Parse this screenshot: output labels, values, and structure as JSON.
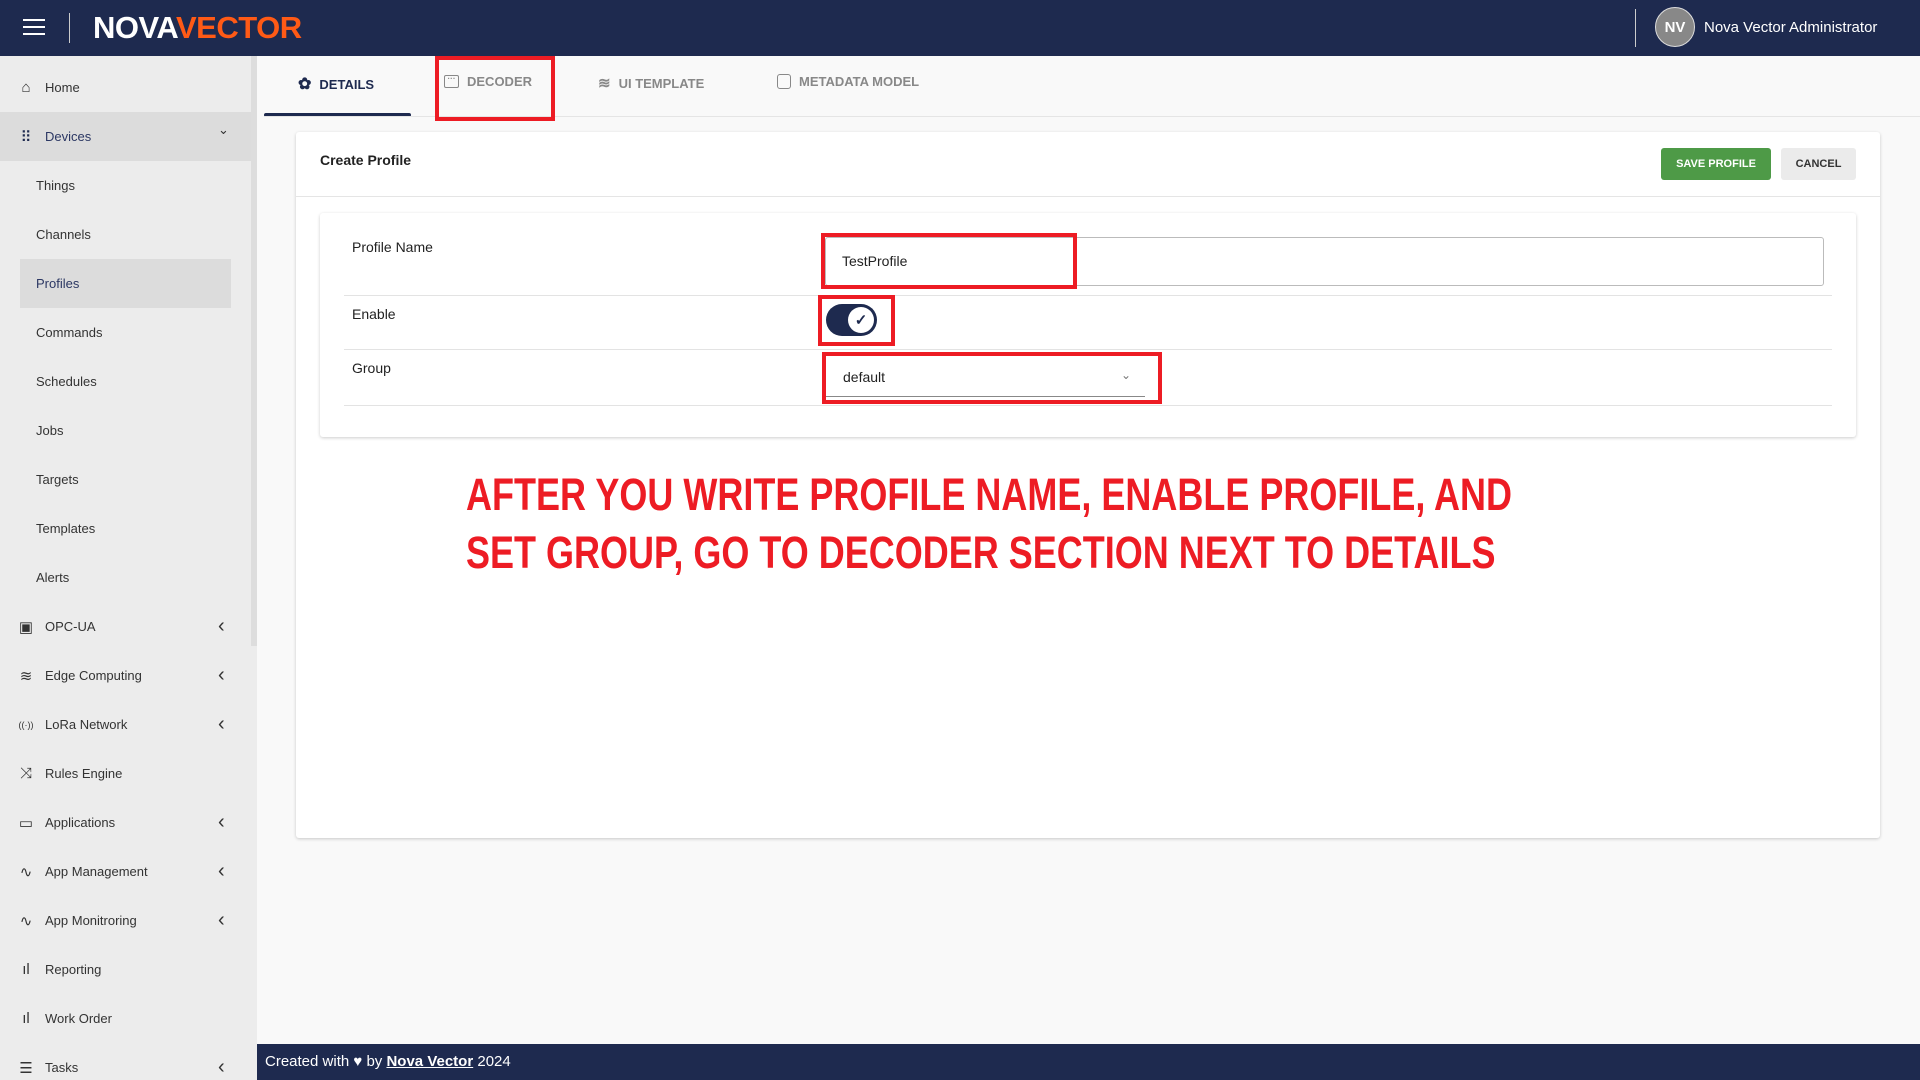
{
  "header": {
    "logo_part1": "NOVA",
    "logo_part2": "VECTOR",
    "avatar_initials": "NV",
    "user_name": "Nova Vector Administrator"
  },
  "sidebar": {
    "items": [
      {
        "label": "Home",
        "icon": "home-icon"
      },
      {
        "label": "Devices",
        "icon": "grid-dots-icon",
        "expanded": true
      },
      {
        "label": "Things"
      },
      {
        "label": "Channels"
      },
      {
        "label": "Profiles",
        "selected": true
      },
      {
        "label": "Commands"
      },
      {
        "label": "Schedules"
      },
      {
        "label": "Jobs"
      },
      {
        "label": "Targets"
      },
      {
        "label": "Templates"
      },
      {
        "label": "Alerts"
      },
      {
        "label": "OPC-UA",
        "icon": "apps-icon"
      },
      {
        "label": "Edge Computing",
        "icon": "layers-icon"
      },
      {
        "label": "LoRa Network",
        "icon": "antenna-icon"
      },
      {
        "label": "Rules Engine",
        "icon": "shuffle-icon"
      },
      {
        "label": "Applications",
        "icon": "monitor-icon"
      },
      {
        "label": "App Management",
        "icon": "activity-icon"
      },
      {
        "label": "App Monitroring",
        "icon": "activity-icon"
      },
      {
        "label": "Reporting",
        "icon": "bar-chart-icon"
      },
      {
        "label": "Work Order",
        "icon": "bar-chart-icon"
      },
      {
        "label": "Tasks",
        "icon": "list-icon"
      }
    ]
  },
  "tabs": [
    {
      "label": "DETAILS",
      "active": true
    },
    {
      "label": "DECODER"
    },
    {
      "label": "UI TEMPLATE"
    },
    {
      "label": "METADATA MODEL"
    }
  ],
  "card": {
    "title": "Create Profile",
    "save_label": "SAVE PROFILE",
    "cancel_label": "CANCEL"
  },
  "form": {
    "profile_name_label": "Profile Name",
    "profile_name_value": "TestProfile",
    "enable_label": "Enable",
    "enable_value": true,
    "group_label": "Group",
    "group_value": "default"
  },
  "annotation": {
    "line1": "AFTER YOU WRITE PROFILE NAME, ENABLE PROFILE, AND",
    "line2": "SET GROUP, GO TO DECODER SECTION NEXT TO DETAILS"
  },
  "footer": {
    "prefix": "Created with ♥ by",
    "link": "Nova Vector",
    "year": "2024"
  },
  "colors": {
    "navy": "#1e2a4f",
    "orange": "#ff5a16",
    "green": "#4e9a47",
    "annotation_red": "#ed1c24"
  }
}
